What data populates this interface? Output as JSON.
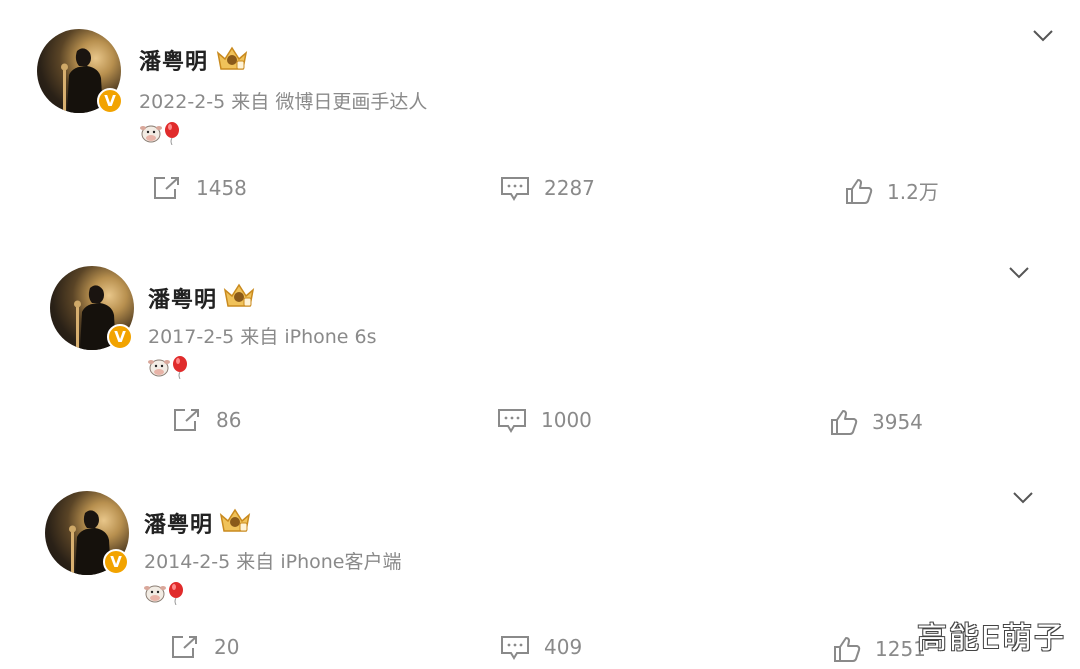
{
  "posts": [
    {
      "author": "潘粤明",
      "verified_badge": "V",
      "date": "2022-2-5",
      "source": "来自 微博日更画手达人",
      "content_emojis": [
        "cow-face-icon",
        "red-balloon-icon"
      ],
      "repost_count": "1458",
      "comment_count": "2287",
      "like_count": "1.2万"
    },
    {
      "author": "潘粤明",
      "verified_badge": "V",
      "date": "2017-2-5",
      "source": "来自 iPhone 6s",
      "content_emojis": [
        "cow-face-icon",
        "red-balloon-icon"
      ],
      "repost_count": "86",
      "comment_count": "1000",
      "like_count": "3954"
    },
    {
      "author": "潘粤明",
      "verified_badge": "V",
      "date": "2014-2-5",
      "source": "来自 iPhone客户端",
      "content_emojis": [
        "cow-face-icon",
        "red-balloon-icon"
      ],
      "repost_count": "20",
      "comment_count": "409",
      "like_count": "1251"
    }
  ],
  "watermark": "高能E萌子",
  "colors": {
    "badge": "#f2a300",
    "meta_text": "#8a8a8a",
    "name_text": "#222222"
  }
}
